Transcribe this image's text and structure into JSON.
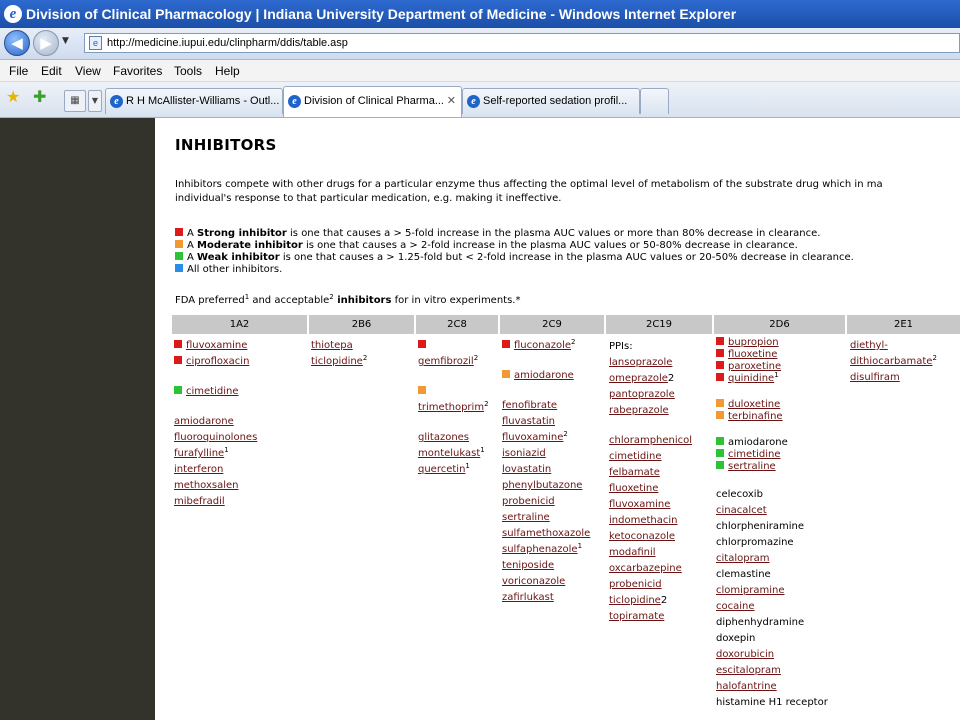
{
  "window": {
    "title": "Division of Clinical Pharmacology | Indiana University Department of Medicine - Windows Internet Explorer"
  },
  "address": {
    "url": "http://medicine.iupui.edu/clinpharm/ddis/table.asp"
  },
  "menu": [
    "File",
    "Edit",
    "View",
    "Favorites",
    "Tools",
    "Help"
  ],
  "tabs": [
    {
      "label": "R H McAllister-Williams - Outl..."
    },
    {
      "label": "Division of Clinical Pharma...",
      "close": "✕"
    },
    {
      "label": "Self-reported sedation profil..."
    }
  ],
  "page": {
    "heading": "INHIBITORS",
    "intro_line1": "Inhibitors compete with other drugs for a particular enzyme thus affecting the optimal level of metabolism of the substrate drug which in ma",
    "intro_line2": "individual's response to that particular medication, e.g. making it ineffective.",
    "legend": [
      {
        "color": "#dd1a1a",
        "prefix": "A ",
        "bold": "Strong inhibitor",
        "rest": " is one that causes a > 5-fold increase in the plasma AUC values or more than 80% decrease in clearance."
      },
      {
        "color": "#f19a35",
        "prefix": "A ",
        "bold": "Moderate inhibitor",
        "rest": " is one that causes a > 2-fold increase in the plasma AUC values or 50-80% decrease in clearance."
      },
      {
        "color": "#2ec238",
        "prefix": "A ",
        "bold": "Weak inhibitor",
        "rest": " is one that causes a > 1.25-fold but < 2-fold increase in the plasma AUC values or 20-50% decrease in clearance."
      },
      {
        "color": "#2a8ee8",
        "prefix": "",
        "bold": "",
        "rest": "All other inhibitors."
      }
    ],
    "fda": {
      "t1": "FDA preferred",
      "s1": "1",
      "t2": " and acceptable",
      "s2": "2",
      "bold": " inhibitors",
      "t3": " for in vitro experiments.*"
    },
    "headers": [
      "1A2",
      "2B6",
      "2C8",
      "2C9",
      "2C19",
      "2D6",
      "2E1"
    ]
  },
  "columns": {
    "1A2": [
      {
        "text": "fluvoxamine",
        "mark": "red",
        "link": true
      },
      {
        "text": "ciprofloxacin",
        "mark": "red",
        "link": true
      },
      {
        "gap": true
      },
      {
        "text": "cimetidine",
        "mark": "green",
        "link": true
      },
      {
        "gap": true
      },
      {
        "text": "amiodarone",
        "link": true
      },
      {
        "text": "fluoroquinolones",
        "link": true
      },
      {
        "text": "furafylline",
        "sup": "1",
        "link": true
      },
      {
        "text": "interferon",
        "link": true
      },
      {
        "text": "methoxsalen",
        "link": true
      },
      {
        "text": "mibefradil",
        "link": true
      }
    ],
    "2B6": [
      {
        "text": "thiotepa",
        "link": true
      },
      {
        "text": "ticlopidine",
        "sup": "2",
        "link": true
      }
    ],
    "2C8": [
      {
        "text": "",
        "mark": "red"
      },
      {
        "text": "gemfibrozil",
        "sup": "2",
        "link": true
      },
      {
        "gap": true
      },
      {
        "text": "",
        "mark": "orange"
      },
      {
        "text": "trimethoprim",
        "sup": "2",
        "link": true
      },
      {
        "gap": true
      },
      {
        "text": "glitazones",
        "link": true
      },
      {
        "text": "montelukast",
        "sup": "1",
        "link": true
      },
      {
        "text": "quercetin",
        "sup": "1",
        "link": true
      }
    ],
    "2C9": [
      {
        "text": "fluconazole",
        "sup": "2",
        "mark": "red",
        "link": true
      },
      {
        "gap": true
      },
      {
        "text": "amiodarone",
        "mark": "orange",
        "link": true
      },
      {
        "gap": true
      },
      {
        "text": "fenofibrate",
        "link": true
      },
      {
        "text": "fluvastatin",
        "link": true
      },
      {
        "text": "fluvoxamine",
        "sup": "2",
        "link": true
      },
      {
        "text": "isoniazid",
        "link": true
      },
      {
        "text": "lovastatin",
        "link": true
      },
      {
        "text": "phenylbutazone",
        "link": true
      },
      {
        "text": "probenicid",
        "link": true
      },
      {
        "text": "sertraline",
        "link": true
      },
      {
        "text": "sulfamethoxazole",
        "link": true
      },
      {
        "text": "sulfaphenazole",
        "sup": "1",
        "link": true
      },
      {
        "text": "teniposide",
        "link": true
      },
      {
        "text": "voriconazole",
        "link": true
      },
      {
        "text": "zafirlukast",
        "link": true
      }
    ],
    "2C19": [
      {
        "text": "PPIs:",
        "link": false
      },
      {
        "text": "lansoprazole",
        "link": true
      },
      {
        "text": "omeprazole",
        "after": "2",
        "link": true
      },
      {
        "text": "pantoprazole",
        "link": true
      },
      {
        "text": "rabeprazole",
        "link": true
      },
      {
        "gap": true
      },
      {
        "text": "chloramphenicol",
        "link": true
      },
      {
        "text": "cimetidine",
        "link": true
      },
      {
        "text": "felbamate",
        "link": true
      },
      {
        "text": "fluoxetine",
        "link": true
      },
      {
        "text": "fluvoxamine",
        "link": true
      },
      {
        "text": "indomethacin",
        "link": true
      },
      {
        "text": "ketoconazole",
        "link": true
      },
      {
        "text": "modafinil",
        "link": true
      },
      {
        "text": "oxcarbazepine",
        "link": true
      },
      {
        "text": "probenicid",
        "link": true
      },
      {
        "text": "ticlopidine",
        "after": "2",
        "link": true
      },
      {
        "text": "topiramate",
        "link": true
      }
    ],
    "2D6": [
      {
        "text": "bupropion",
        "mark": "red",
        "link": true,
        "tight": true
      },
      {
        "text": "fluoxetine",
        "mark": "red",
        "link": true,
        "tight": true
      },
      {
        "text": "paroxetine",
        "mark": "red",
        "link": true,
        "tight": true
      },
      {
        "text": "quinidine",
        "sup": "1",
        "mark": "red",
        "link": true,
        "tight": true
      },
      {
        "gap": true
      },
      {
        "text": "duloxetine",
        "mark": "orange",
        "link": true,
        "tight": true
      },
      {
        "text": "terbinafine",
        "mark": "orange",
        "link": true,
        "tight": true
      },
      {
        "gap": true
      },
      {
        "text": "amiodarone",
        "mark": "green",
        "link": false,
        "tight": true
      },
      {
        "text": "cimetidine",
        "mark": "green",
        "link": true,
        "tight": true
      },
      {
        "text": "sertraline",
        "mark": "green",
        "link": true,
        "tight": true
      },
      {
        "gap": true
      },
      {
        "text": "celecoxib",
        "link": false
      },
      {
        "text": "cinacalcet",
        "link": true
      },
      {
        "text": "chlorpheniramine",
        "link": false
      },
      {
        "text": "chlorpromazine",
        "link": false
      },
      {
        "text": "citalopram",
        "link": true
      },
      {
        "text": "clemastine",
        "link": false
      },
      {
        "text": "clomipramine",
        "link": true
      },
      {
        "text": "cocaine",
        "link": true
      },
      {
        "text": "diphenhydramine",
        "link": false
      },
      {
        "text": "doxepin",
        "link": false
      },
      {
        "text": "doxorubicin",
        "link": true
      },
      {
        "text": "escitalopram",
        "link": true
      },
      {
        "text": "halofantrine",
        "link": true
      },
      {
        "text": "histamine H1 receptor",
        "link": false
      }
    ],
    "2E1": [
      {
        "text": "diethyl-",
        "link": true
      },
      {
        "text": "dithiocarbamate",
        "sup": "2",
        "link": true
      },
      {
        "text": "disulfiram",
        "link": true
      }
    ]
  }
}
